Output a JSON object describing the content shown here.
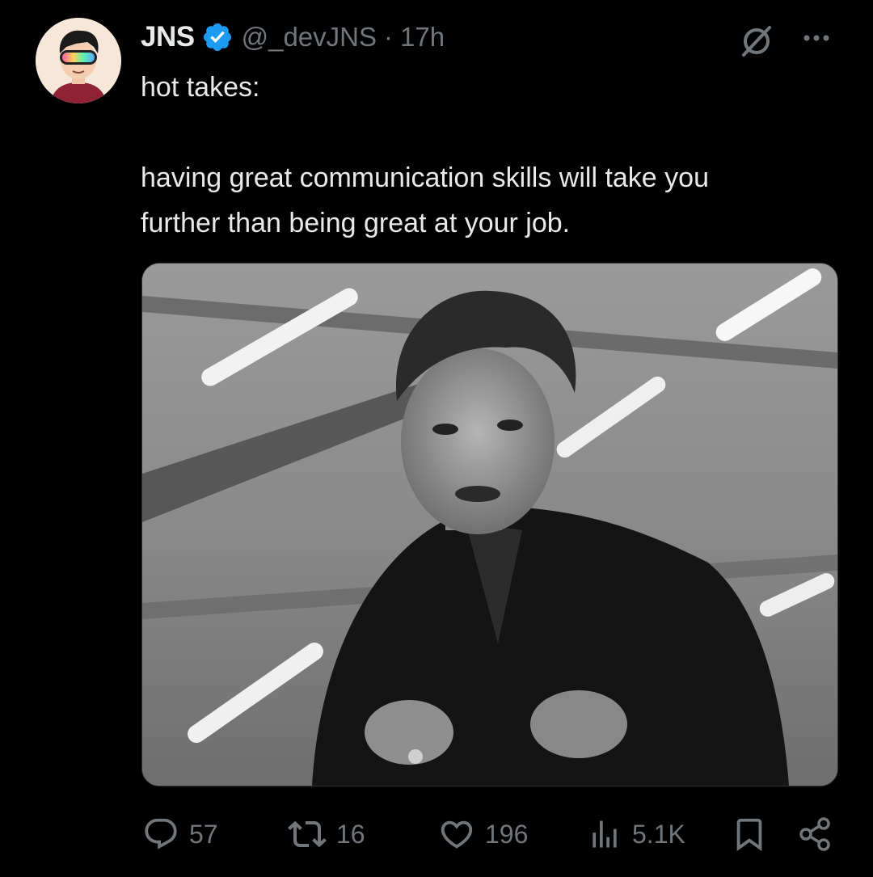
{
  "tweet": {
    "author": {
      "display_name": "JNS",
      "handle": "@_devJNS",
      "verified": true,
      "avatar_icon": "cartoon-avatar-with-vr-headset"
    },
    "separator": "·",
    "time": "17h",
    "text": "hot takes:\n\nhaving great communication skills will take you\nfurther than being great at your job.",
    "media": {
      "type": "photo",
      "tone": "black-and-white"
    },
    "stats": {
      "replies": "57",
      "reposts": "16",
      "likes": "196",
      "views": "5.1K"
    }
  },
  "icons": {
    "verified": "verified-badge-icon",
    "grok": "grok-icon",
    "more": "more-icon",
    "reply": "reply-icon",
    "repost": "repost-icon",
    "like": "heart-icon",
    "views": "views-icon",
    "bookmark": "bookmark-icon",
    "share": "share-icon"
  },
  "colors": {
    "background": "#000000",
    "text": "#e7e9ea",
    "secondary": "#71767b",
    "verified": "#1d9bf0",
    "border": "#2f3336"
  }
}
